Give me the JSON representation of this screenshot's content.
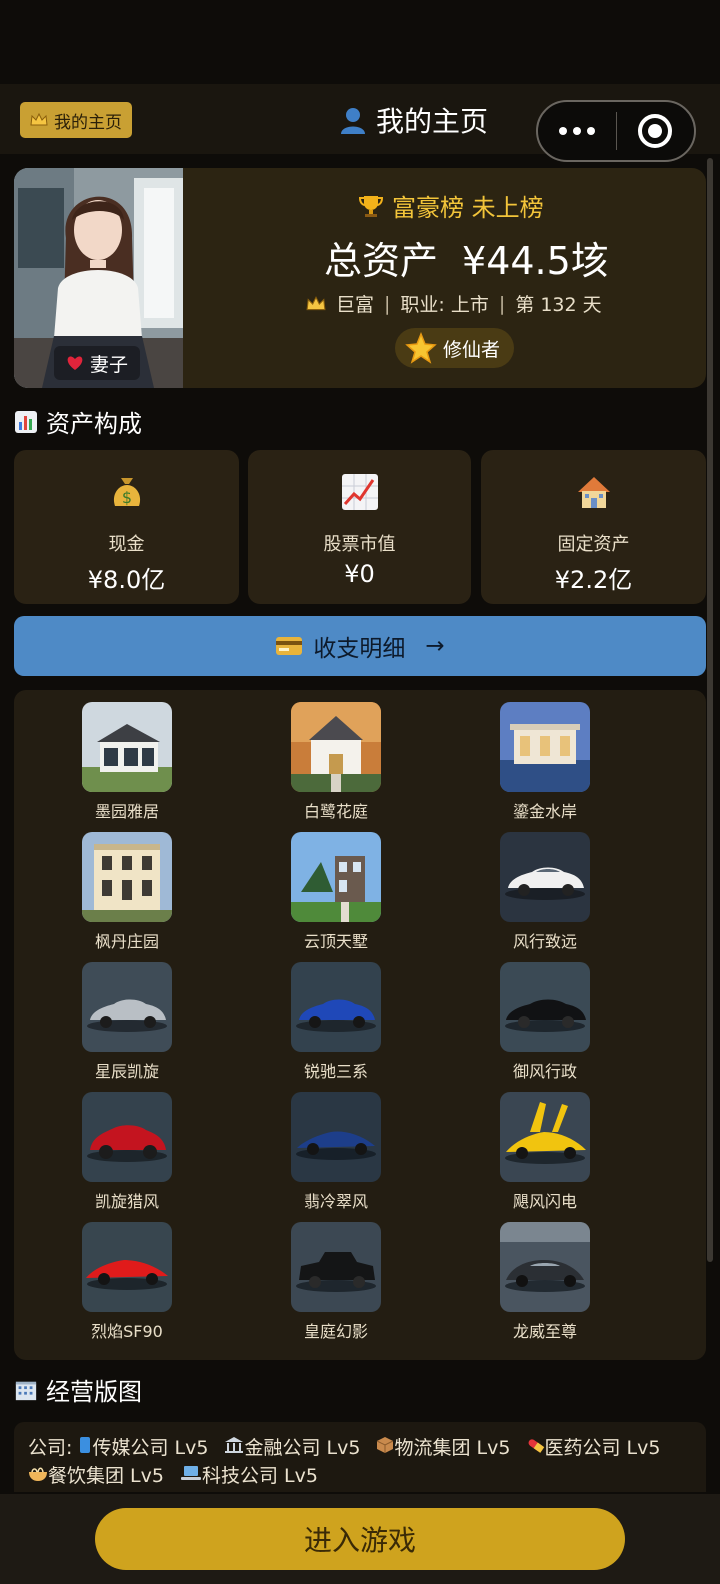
{
  "header": {
    "home_badge": "我的主页",
    "title": "我的主页",
    "colors": {
      "badge": "#c9a033",
      "background": "#1a160f"
    }
  },
  "profile": {
    "wife_label": "妻子",
    "rank_label": "富豪榜 未上榜",
    "total_label": "总资产",
    "total_value": "¥44.5垓",
    "level": "巨富",
    "career": "职业: 上市",
    "day": "第 132 天",
    "title_badge": "修仙者"
  },
  "assets": {
    "section_title": "资产构成",
    "cards": [
      {
        "icon": "money-bag-icon",
        "label": "现金",
        "value": "¥8.0亿"
      },
      {
        "icon": "stock-chart-icon",
        "label": "股票市值",
        "value": "¥0"
      },
      {
        "icon": "house-icon",
        "label": "固定资产",
        "value": "¥2.2亿"
      }
    ]
  },
  "detail_button": {
    "label": "收支明细",
    "arrow": "→",
    "color": "#4e8ac6"
  },
  "gallery": {
    "items": [
      {
        "label": "墨园雅居",
        "kind": "house"
      },
      {
        "label": "白鹭花庭",
        "kind": "house"
      },
      {
        "label": "鎏金水岸",
        "kind": "house"
      },
      {
        "label": "枫丹庄园",
        "kind": "house"
      },
      {
        "label": "云顶天墅",
        "kind": "house"
      },
      {
        "label": "风行致远",
        "kind": "car"
      },
      {
        "label": "星辰凯旋",
        "kind": "car"
      },
      {
        "label": "锐驰三系",
        "kind": "car"
      },
      {
        "label": "御风行政",
        "kind": "car"
      },
      {
        "label": "凯旋猎风",
        "kind": "car"
      },
      {
        "label": "翡冷翠风",
        "kind": "car"
      },
      {
        "label": "飓风闪电",
        "kind": "car"
      },
      {
        "label": "烈焰SF90",
        "kind": "car"
      },
      {
        "label": "皇庭幻影",
        "kind": "car"
      },
      {
        "label": "龙威至尊",
        "kind": "car"
      }
    ]
  },
  "business": {
    "section_title": "经营版图",
    "prefix": "公司:",
    "companies": [
      {
        "icon": "phone-icon",
        "label": "传媒公司 Lv5"
      },
      {
        "icon": "bank-icon",
        "label": "金融公司 Lv5"
      },
      {
        "icon": "package-icon",
        "label": "物流集团 Lv5"
      },
      {
        "icon": "pill-icon",
        "label": "医药公司 Lv5"
      },
      {
        "icon": "noodle-bowl-icon",
        "label": "餐饮集团 Lv5"
      },
      {
        "icon": "laptop-icon",
        "label": "科技公司 Lv5"
      }
    ]
  },
  "footer": {
    "enter_label": "进入游戏",
    "color": "#cfa31e"
  }
}
